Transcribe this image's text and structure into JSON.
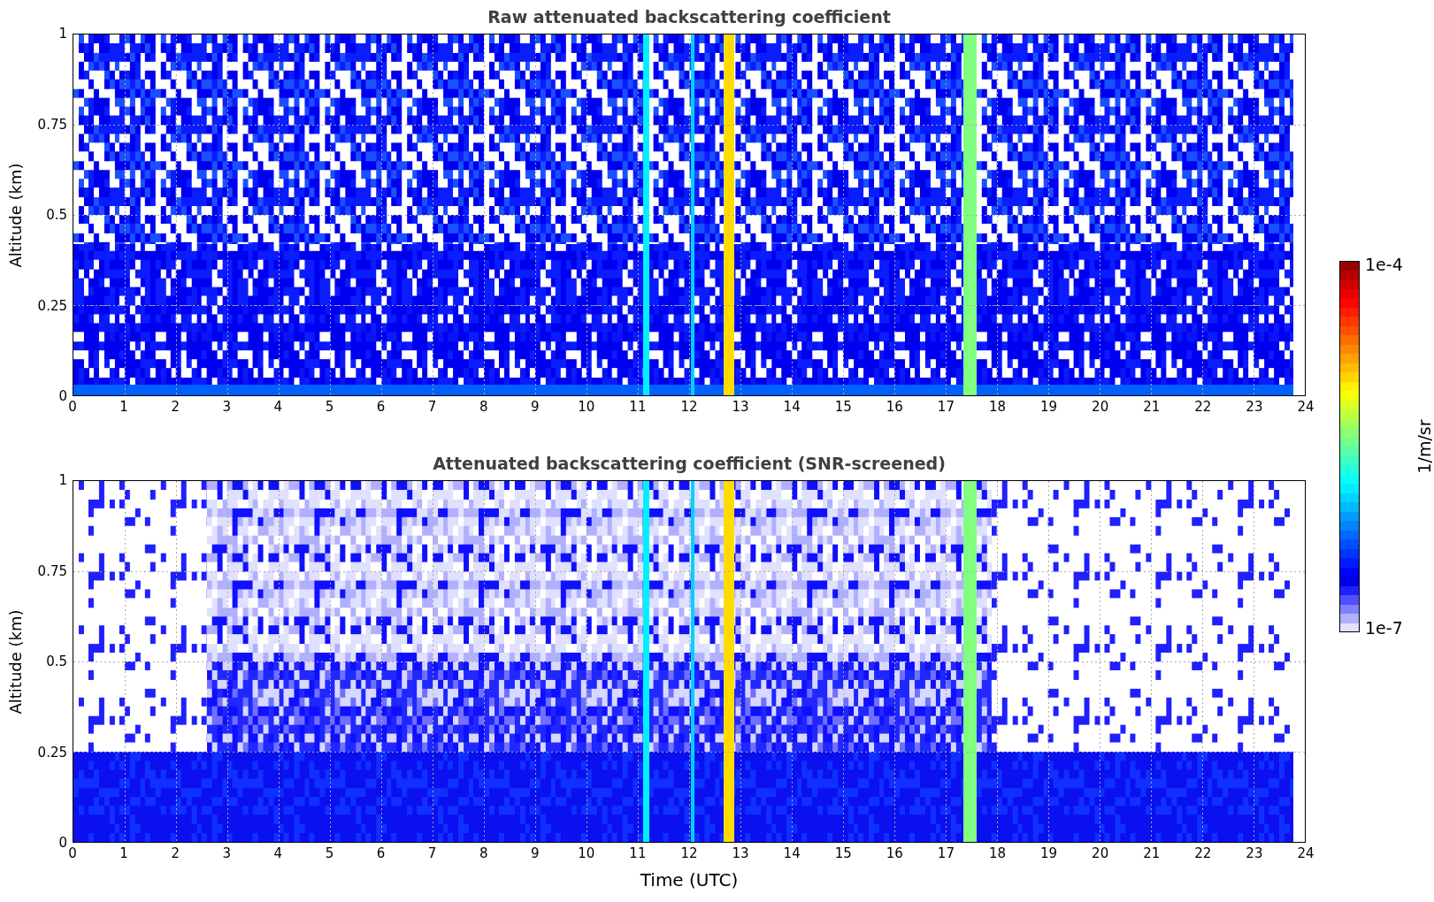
{
  "panels": [
    {
      "kind": "raw",
      "title": "Raw attenuated backscattering coefficient",
      "ylabel": "Altitude (km)",
      "yticks": [
        "1",
        "0.75",
        "0.5",
        "0.25",
        "0"
      ],
      "xticks": [
        "0",
        "1",
        "2",
        "3",
        "4",
        "5",
        "6",
        "7",
        "8",
        "9",
        "10",
        "11",
        "12",
        "13",
        "14",
        "15",
        "16",
        "17",
        "18",
        "19",
        "20",
        "21",
        "22",
        "23",
        "24"
      ]
    },
    {
      "kind": "screened",
      "title": "Attenuated backscattering coefficient (SNR-screened)",
      "ylabel": "Altitude (km)",
      "yticks": [
        "1",
        "0.75",
        "0.5",
        "0.25",
        "0"
      ],
      "xticks": [
        "0",
        "1",
        "2",
        "3",
        "4",
        "5",
        "6",
        "7",
        "8",
        "9",
        "10",
        "11",
        "12",
        "13",
        "14",
        "15",
        "16",
        "17",
        "18",
        "19",
        "20",
        "21",
        "22",
        "23",
        "24"
      ],
      "xlabel": "Time (UTC)"
    }
  ],
  "colorbar": {
    "max_label": "1e-4",
    "min_label": "1e-7",
    "label": "1/m/sr"
  }
}
